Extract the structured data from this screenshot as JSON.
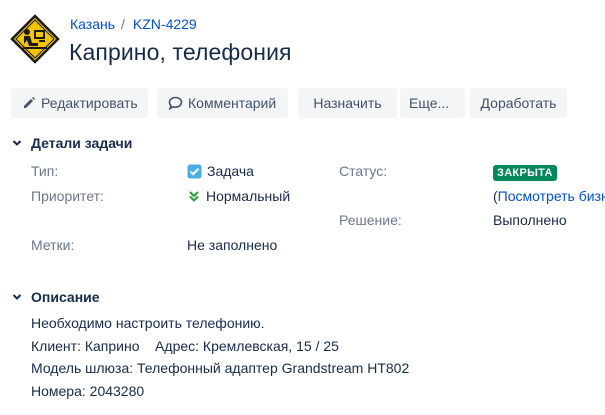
{
  "breadcrumbs": {
    "project": "Казань",
    "separator": "/",
    "issue_key": "KZN-4229"
  },
  "issue": {
    "title": "Каприно, телефония"
  },
  "toolbar": {
    "edit": "Редактировать",
    "comment": "Комментарий",
    "assign": "Назначить",
    "more": "Еще...",
    "return": "Доработать"
  },
  "details": {
    "heading": "Детали задачи",
    "type_label": "Тип:",
    "type_value": "Задача",
    "priority_label": "Приоритет:",
    "priority_value": "Нормальный",
    "labels_label": "Метки:",
    "labels_value": "Не заполнено",
    "status_label": "Статус:",
    "status_value": "ЗАКРЫТА",
    "status_link_paren": "(",
    "status_link": "Посмотреть бизн",
    "resolution_label": "Решение:",
    "resolution_value": "Выполнено"
  },
  "description": {
    "heading": "Описание",
    "lines": [
      "Необходимо настроить телефонию.",
      "Клиент: Каприно    Адрес: Кремлевская, 15 / 25",
      "Модель шлюза: Телефонный адаптер Grandstream HT802",
      "Номера: 2043280"
    ]
  },
  "colors": {
    "link": "#0052cc",
    "status_done": "#00875a",
    "button_bg": "#f4f5f7"
  },
  "icons": {
    "avatar": "person-at-computer-warning-sign",
    "edit": "pencil-icon",
    "comment": "speech-bubble-icon",
    "more": "chevron-down-icon",
    "section": "chevron-down-icon",
    "type": "checkbox-task-icon",
    "priority": "double-chevron-down-icon"
  }
}
